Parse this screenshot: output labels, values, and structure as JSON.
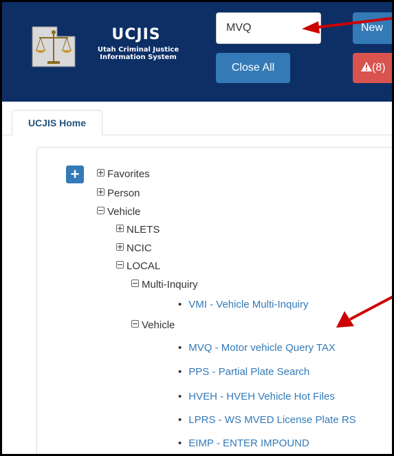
{
  "header": {
    "logo_title": "UCJIS",
    "logo_subtitle_line1": "Utah Criminal Justice",
    "logo_subtitle_line2": "Information System",
    "search_value": "MVQ",
    "new_button": "New",
    "close_all_button": "Close All",
    "alert_button": "(8)",
    "colors": {
      "header_bg": "#0d2f66",
      "primary": "#337ab7",
      "danger": "#d9534f",
      "arrow": "#cc0000"
    }
  },
  "tabs": [
    {
      "label": "UCJIS Home"
    }
  ],
  "menu": {
    "expand_all_label": "+",
    "tree": {
      "favorites": "Favorites",
      "person": "Person",
      "vehicle": "Vehicle",
      "nlets": "NLETS",
      "ncic": "NCIC",
      "local": "LOCAL",
      "multi_inquiry": "Multi-Inquiry",
      "vmi": "VMI - Vehicle Multi-Inquiry",
      "vehicle_sub": "Vehicle",
      "leaves": [
        "MVQ - Motor vehicle Query TAX",
        "PPS - Partial Plate Search",
        "HVEH - HVEH Vehicle Hot Files",
        "LPRS - WS MVED License Plate RS",
        "EIMP - ENTER IMPOUND"
      ]
    }
  }
}
